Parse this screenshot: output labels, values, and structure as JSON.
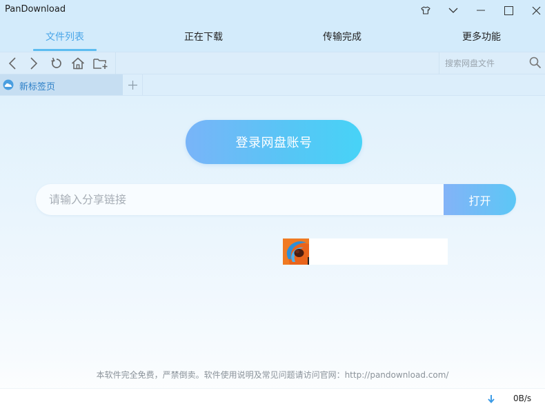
{
  "app": {
    "title": "PanDownload"
  },
  "window_controls": {
    "skin_icon": "tshirt-icon",
    "menu_icon": "chevron-down-icon",
    "minimize_icon": "minimize-icon",
    "maximize_icon": "maximize-icon",
    "close_icon": "close-icon"
  },
  "main_tabs": [
    {
      "label": "文件列表",
      "active": true
    },
    {
      "label": "正在下载",
      "active": false
    },
    {
      "label": "传输完成",
      "active": false
    },
    {
      "label": "更多功能",
      "active": false
    }
  ],
  "toolbar": {
    "icons": [
      "back-icon",
      "forward-icon",
      "refresh-icon",
      "home-icon",
      "new-folder-icon"
    ],
    "search": {
      "placeholder": "搜索网盘文件",
      "value": "",
      "icon": "search-icon"
    }
  },
  "browser_tabs": [
    {
      "label": "新标签页",
      "icon": "cloud-icon",
      "active": true
    }
  ],
  "add_tab_icon": "plus-icon",
  "login": {
    "label": "登录网盘账号"
  },
  "share": {
    "placeholder": "请输入分享链接",
    "value": "",
    "open_label": "打开"
  },
  "notice": {
    "text": "本软件完全免费，严禁倒卖。软件使用说明及常见问题请访问官网：",
    "url": "http://pandownload.com/"
  },
  "status": {
    "download_icon": "download-arrow-icon",
    "speed": "0B/s"
  },
  "colors": {
    "accent": "#4aa6e8",
    "titlebar_bg": "#d3ebfb",
    "button_gradient_start": "#79b4f8",
    "button_gradient_end": "#47d3f7"
  }
}
